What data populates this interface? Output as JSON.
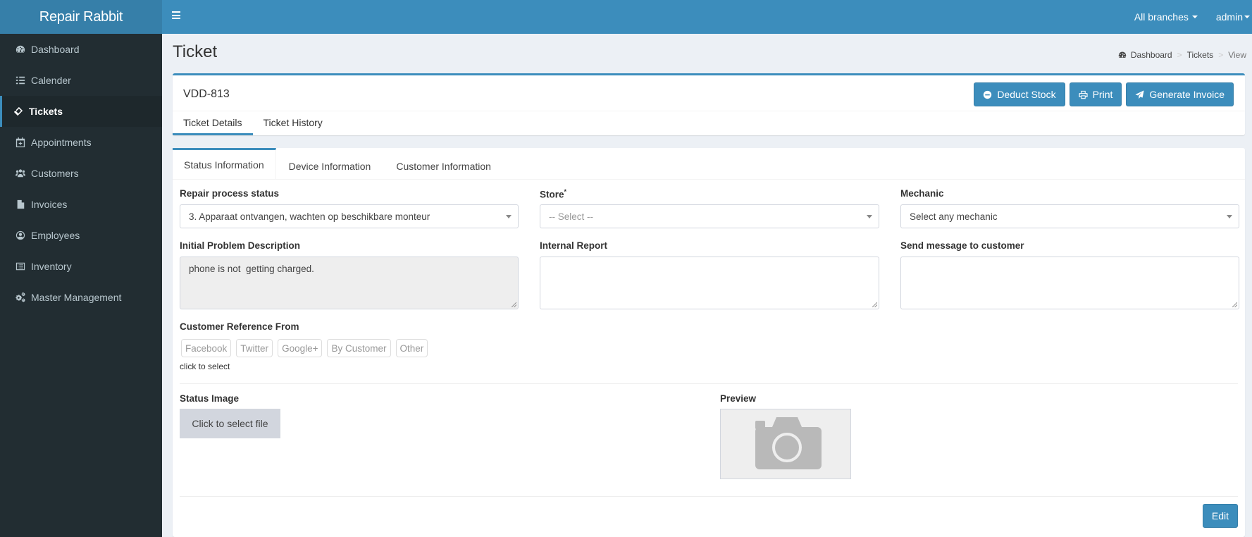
{
  "app": {
    "name": "Repair Rabbit"
  },
  "sidebar": {
    "items": [
      {
        "label": "Dashboard",
        "icon": "dashboard-icon",
        "active": false
      },
      {
        "label": "Calender",
        "icon": "list-icon",
        "active": false
      },
      {
        "label": "Tickets",
        "icon": "ticket-icon",
        "active": true
      },
      {
        "label": "Appointments",
        "icon": "calendar-plus-icon",
        "active": false
      },
      {
        "label": "Customers",
        "icon": "users-icon",
        "active": false
      },
      {
        "label": "Invoices",
        "icon": "file-text-icon",
        "active": false
      },
      {
        "label": "Employees",
        "icon": "user-circle-icon",
        "active": false
      },
      {
        "label": "Inventory",
        "icon": "list-alt-icon",
        "active": false
      },
      {
        "label": "Master Management",
        "icon": "cogs-icon",
        "active": false
      }
    ]
  },
  "topbar": {
    "branch_menu": "All branches",
    "user_menu": "admin"
  },
  "page": {
    "title": "Ticket",
    "breadcrumb": [
      "Dashboard",
      "Tickets",
      "View"
    ]
  },
  "ticket": {
    "id": "VDD-813",
    "actions": {
      "deduct_stock": "Deduct Stock",
      "print": "Print",
      "generate_invoice": "Generate Invoice"
    },
    "subtabs": [
      {
        "label": "Ticket Details",
        "active": true
      },
      {
        "label": "Ticket History",
        "active": false
      }
    ]
  },
  "details": {
    "tabs": [
      {
        "label": "Status Information",
        "active": true
      },
      {
        "label": "Device Information",
        "active": false
      },
      {
        "label": "Customer Information",
        "active": false
      }
    ],
    "repair_status": {
      "label": "Repair process status",
      "value": "3. Apparaat ontvangen, wachten op beschikbare monteur"
    },
    "store": {
      "label": "Store",
      "required_mark": "*",
      "placeholder": "-- Select --"
    },
    "mechanic": {
      "label": "Mechanic",
      "value": "Select any mechanic"
    },
    "initial_problem": {
      "label": "Initial Problem Description",
      "value": "phone is not  getting charged."
    },
    "internal_report": {
      "label": "Internal Report",
      "value": ""
    },
    "customer_message": {
      "label": "Send message to customer",
      "value": ""
    },
    "customer_reference": {
      "label": "Customer Reference From",
      "options": [
        "Facebook",
        "Twitter",
        "Google+",
        "By Customer",
        "Other"
      ],
      "hint": "click to select"
    },
    "status_image": {
      "label": "Status Image",
      "button": "Click to select file"
    },
    "preview": {
      "label": "Preview",
      "icon": "camera-icon"
    },
    "edit_button": "Edit"
  },
  "colors": {
    "primary": "#3c8dbc",
    "primary_dark": "#367fa9",
    "sidebar_bg": "#222d32",
    "content_bg": "#ecf0f5"
  }
}
